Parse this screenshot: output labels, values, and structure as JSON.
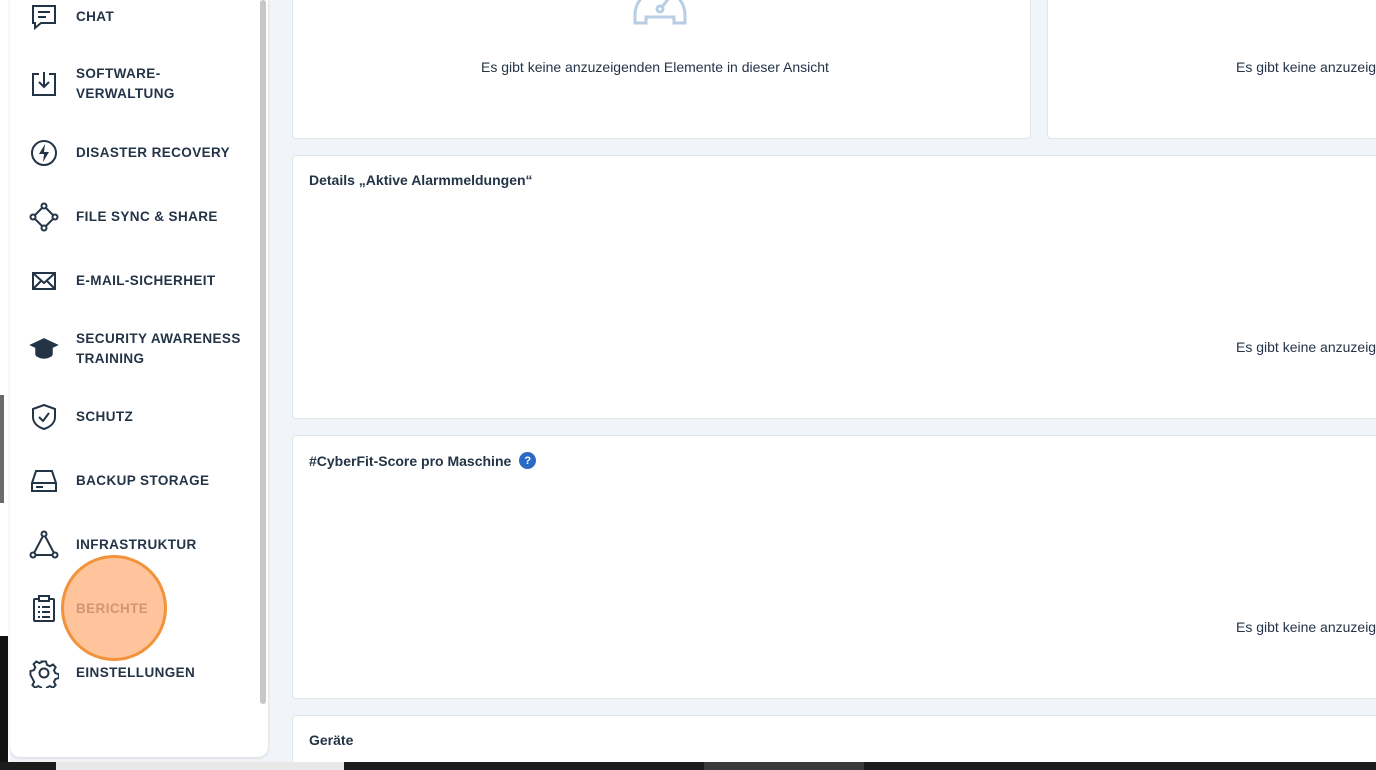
{
  "sidebar": {
    "items": [
      {
        "label": "CHAT",
        "icon": "chat-icon"
      },
      {
        "label": "SOFTWARE-\nVERWALTUNG",
        "icon": "software-download-icon"
      },
      {
        "label": "DISASTER RECOVERY",
        "icon": "lightning-icon"
      },
      {
        "label": "FILE SYNC & SHARE",
        "icon": "file-sync-icon"
      },
      {
        "label": "E-MAIL-SICHERHEIT",
        "icon": "envelope-icon"
      },
      {
        "label": "SECURITY AWARENESS TRAINING",
        "icon": "graduation-cap-icon"
      },
      {
        "label": "SCHUTZ",
        "icon": "shield-check-icon"
      },
      {
        "label": "BACKUP STORAGE",
        "icon": "hard-drive-icon"
      },
      {
        "label": "INFRASTRUKTUR",
        "icon": "triangle-nodes-icon"
      },
      {
        "label": "BERICHTE",
        "icon": "clipboard-report-icon"
      },
      {
        "label": "EINSTELLUNGEN",
        "icon": "gear-icon"
      }
    ]
  },
  "cards": {
    "top_left_empty": "Es gibt keine anzuzeigenden Elemente in dieser Ansicht",
    "top_right_empty": "Es gibt keine anzuzeig",
    "alarms": {
      "title": "Details „Aktive Alarmmeldungen“",
      "empty": "Es gibt keine anzuzeig"
    },
    "cyberfit": {
      "title": "#CyberFit-Score pro Maschine",
      "help": "?",
      "empty": "Es gibt keine anzuzeig"
    },
    "devices": {
      "title": "Geräte"
    }
  },
  "colors": {
    "accent": "#2a69c4",
    "text": "#243447",
    "highlight": "#f2923a",
    "background": "#f1f4f8"
  }
}
